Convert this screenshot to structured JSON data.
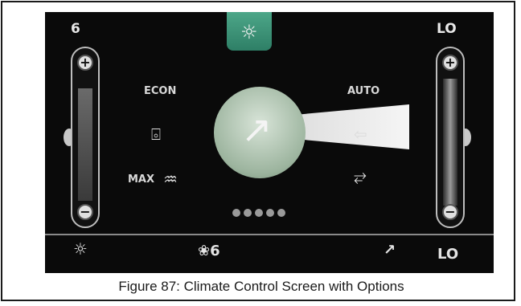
{
  "screen": {
    "left_temp": "6",
    "right_temp": "LO",
    "left_slider": {
      "plus": "+",
      "minus": "−"
    },
    "right_slider": {
      "plus": "+",
      "minus": "−"
    },
    "front_defrost_icon": "☼",
    "options": {
      "econ": "ECON",
      "max": "MAX",
      "auto": "AUTO"
    },
    "icons": {
      "rear_defrost": "⌻",
      "max_defrost": "♒",
      "fresh_air": "⇦",
      "recirculation": "⥂",
      "airflow_mode": "↗"
    },
    "page_dots": 5,
    "bottom_bar": {
      "defrost_icon": "☼",
      "fan_label": "❀6",
      "vent_icon": "↗",
      "temp": "LO"
    }
  },
  "caption": "Figure 87: Climate Control Screen with Options"
}
